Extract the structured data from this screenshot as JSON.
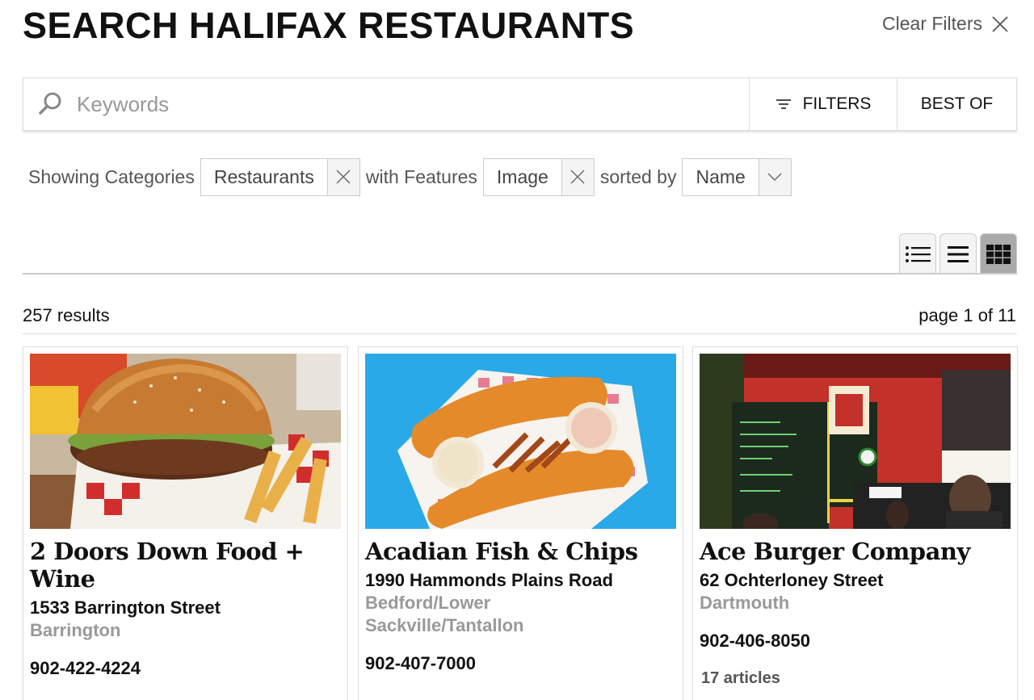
{
  "page": {
    "title": "SEARCH HALIFAX RESTAURANTS"
  },
  "clear_filters": {
    "label": "Clear Filters"
  },
  "search": {
    "placeholder": "Keywords",
    "filters_label": "FILTERS",
    "best_of_label": "BEST OF"
  },
  "filter_row": {
    "showing_text": "Showing Categories",
    "category_chip": "Restaurants",
    "features_text": "with Features",
    "feature_chip": "Image",
    "sorted_text": "sorted by",
    "sort_value": "Name"
  },
  "results": {
    "count": "257 results",
    "page": "page 1 of 11"
  },
  "colors": {
    "accent_active_view": "#aaaaaa",
    "muted_text": "#999999"
  },
  "icons": [
    "close-icon",
    "search-icon",
    "filter-icon",
    "chevron-down-icon",
    "list-bulleted-icon",
    "list-compact-icon",
    "grid-icon"
  ],
  "cards": [
    {
      "name": "2 Doors Down Food + Wine",
      "address": "1533 Barrington Street",
      "area": "Barrington",
      "phone": "902-422-4224",
      "articles": "",
      "image": "burger-with-fries-photo"
    },
    {
      "name": "Acadian Fish & Chips",
      "address": "1990 Hammonds Plains Road",
      "area": "Bedford/Lower Sackville/Tantallon",
      "phone": "902-407-7000",
      "articles": "",
      "image": "fish-and-chips-photo"
    },
    {
      "name": "Ace Burger Company",
      "address": "62 Ochterloney Street",
      "area": "Dartmouth",
      "phone": "902-406-8050",
      "articles": "17 articles",
      "image": "restaurant-interior-photo"
    }
  ]
}
